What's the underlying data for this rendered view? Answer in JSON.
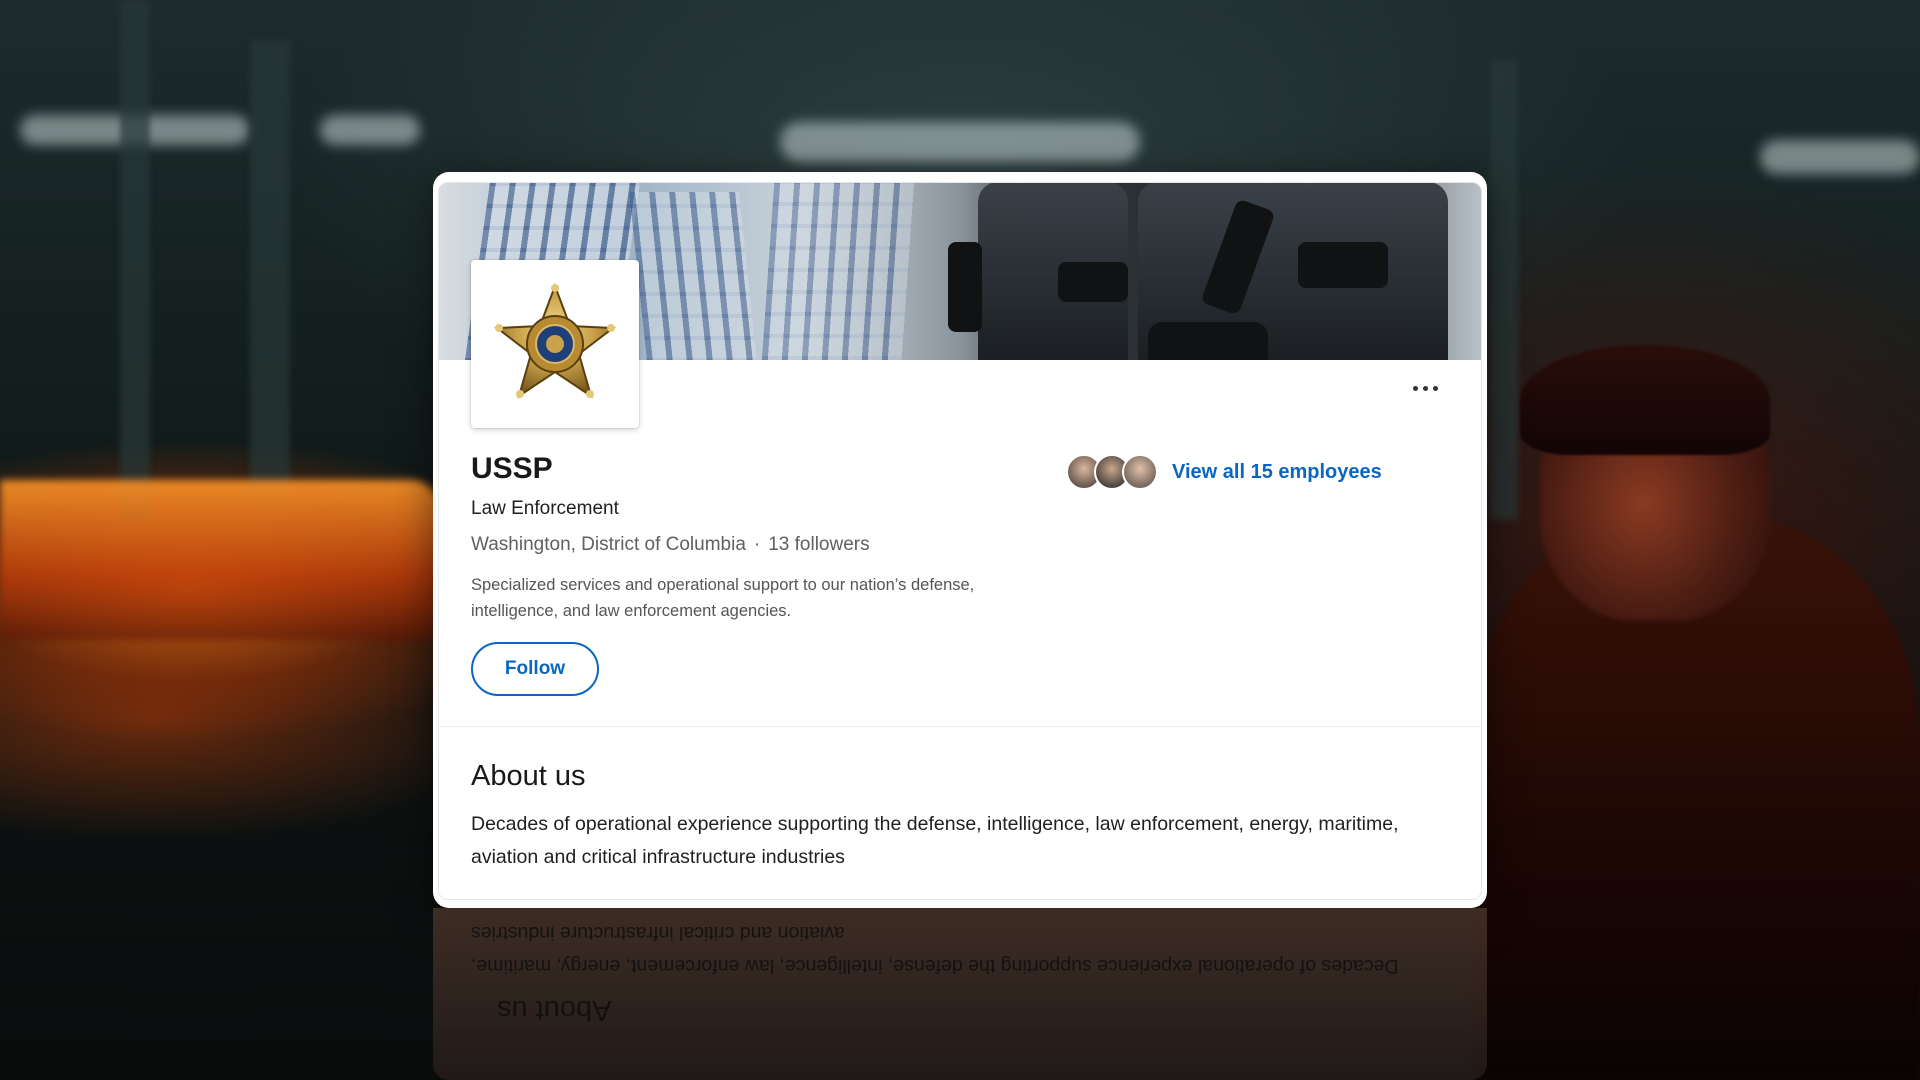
{
  "company": {
    "name": "USSP",
    "industry": "Law Enforcement",
    "location": "Washington, District of Columbia",
    "separator": "·",
    "followers": "13 followers",
    "tagline": "Specialized services and operational support to our nation’s defense, intelligence, and law enforcement agencies.",
    "logo_icon": "police-star-badge-icon"
  },
  "actions": {
    "follow_label": "Follow",
    "more_icon": "ellipsis-icon"
  },
  "employees": {
    "link_label": "View all 15 employees",
    "avatar_count": 3
  },
  "about": {
    "title": "About us",
    "text": "Decades of operational experience supporting the defense, intelligence, law enforcement, energy, maritime, aviation and critical infrastructure industries"
  },
  "colors": {
    "accent": "#0a66c2",
    "badge_gold": "#c9a24a"
  }
}
